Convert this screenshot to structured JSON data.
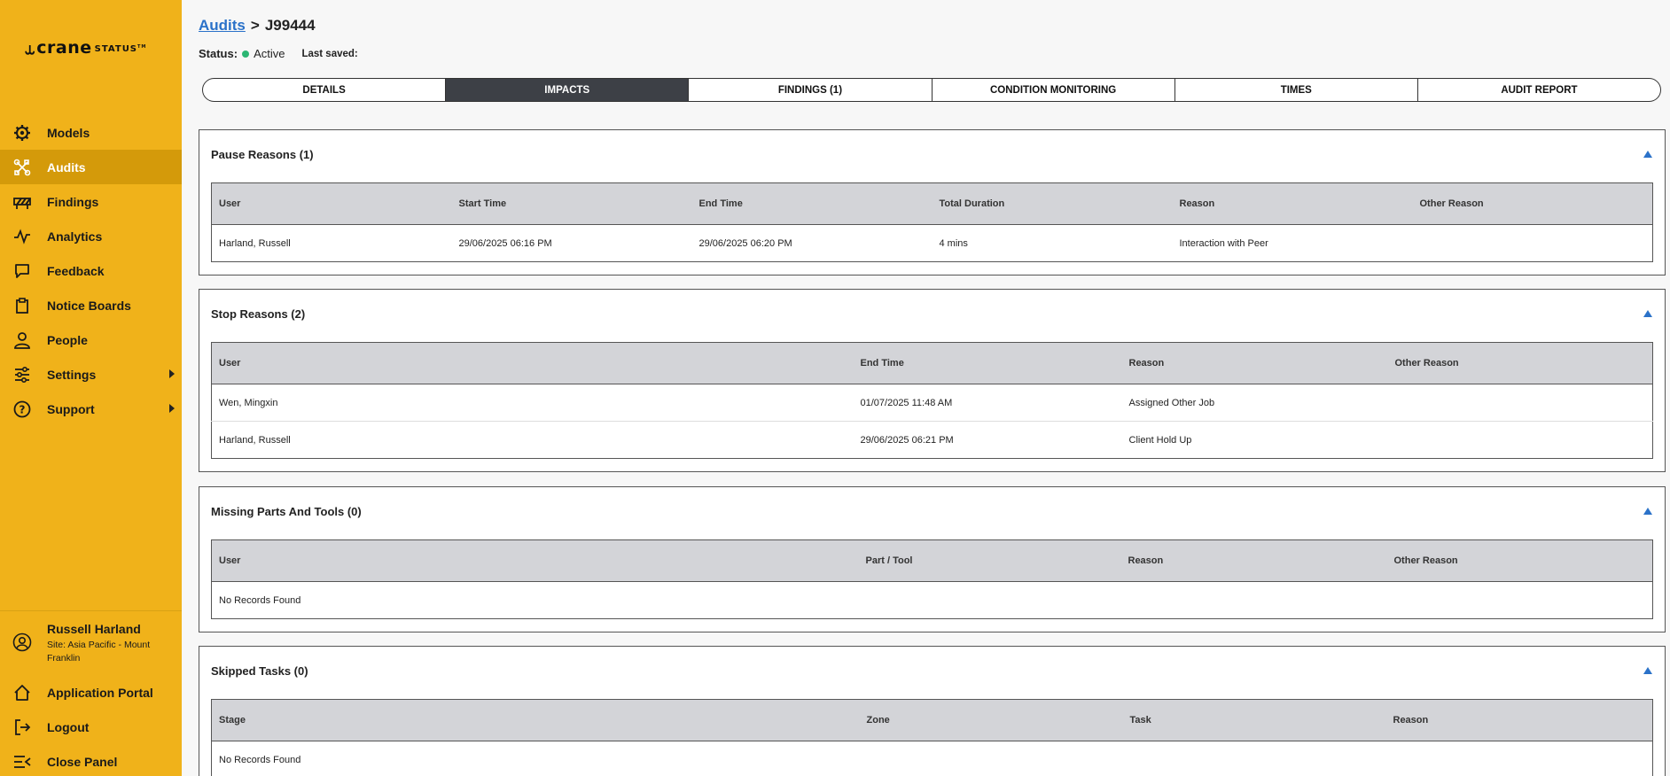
{
  "brand": {
    "hook": "⥿",
    "crane": "crane",
    "status": "STATUS",
    "tm": "TM"
  },
  "sidebar": {
    "items": [
      {
        "label": "Models",
        "icon": "gear-icon"
      },
      {
        "label": "Audits",
        "icon": "tools-icon"
      },
      {
        "label": "Findings",
        "icon": "barrier-icon"
      },
      {
        "label": "Analytics",
        "icon": "pulse-icon"
      },
      {
        "label": "Feedback",
        "icon": "chat-icon"
      },
      {
        "label": "Notice Boards",
        "icon": "clipboard-icon"
      },
      {
        "label": "People",
        "icon": "person-icon"
      },
      {
        "label": "Settings",
        "icon": "sliders-icon"
      },
      {
        "label": "Support",
        "icon": "help-icon"
      }
    ],
    "user": {
      "name": "Russell Harland",
      "site": "Site: Asia Pacific - Mount Franklin"
    },
    "bottom": [
      {
        "label": "Application Portal",
        "icon": "home-icon"
      },
      {
        "label": "Logout",
        "icon": "logout-icon"
      },
      {
        "label": "Close Panel",
        "icon": "collapse-menu-icon"
      }
    ]
  },
  "header": {
    "breadcrumb_link": "Audits",
    "breadcrumb_sep": ">",
    "breadcrumb_current": "J99444",
    "status_label": "Status:",
    "status_value": "Active",
    "last_saved_label": "Last saved:",
    "status_color": "#2bb673"
  },
  "tabs": [
    "DETAILS",
    "IMPACTS",
    "FINDINGS (1)",
    "CONDITION MONITORING",
    "TIMES",
    "AUDIT REPORT"
  ],
  "pause": {
    "title": "Pause Reasons (1)",
    "columns": [
      "User",
      "Start Time",
      "End Time",
      "Total Duration",
      "Reason",
      "Other Reason"
    ],
    "rows": [
      [
        "Harland, Russell",
        "29/06/2025 06:16 PM",
        "29/06/2025 06:20 PM",
        "4 mins",
        "Interaction with Peer",
        ""
      ]
    ]
  },
  "stop": {
    "title": "Stop Reasons (2)",
    "columns": [
      "User",
      "End Time",
      "Reason",
      "Other Reason"
    ],
    "rows": [
      [
        "Wen, Mingxin",
        "01/07/2025 11:48 AM",
        "Assigned Other Job",
        ""
      ],
      [
        "Harland, Russell",
        "29/06/2025 06:21 PM",
        "Client Hold Up",
        ""
      ]
    ]
  },
  "missing": {
    "title": "Missing Parts And Tools (0)",
    "columns": [
      "User",
      "Part / Tool",
      "Reason",
      "Other Reason"
    ],
    "empty": "No Records Found"
  },
  "skipped": {
    "title": "Skipped Tasks (0)",
    "columns": [
      "Stage",
      "Zone",
      "Task",
      "Reason"
    ],
    "empty": "No Records Found"
  },
  "colors": {
    "sidebar": "#f0b21a",
    "sidebar_active": "#d49a0a",
    "accent": "#2b72c9",
    "tab_active": "#3d4046"
  }
}
